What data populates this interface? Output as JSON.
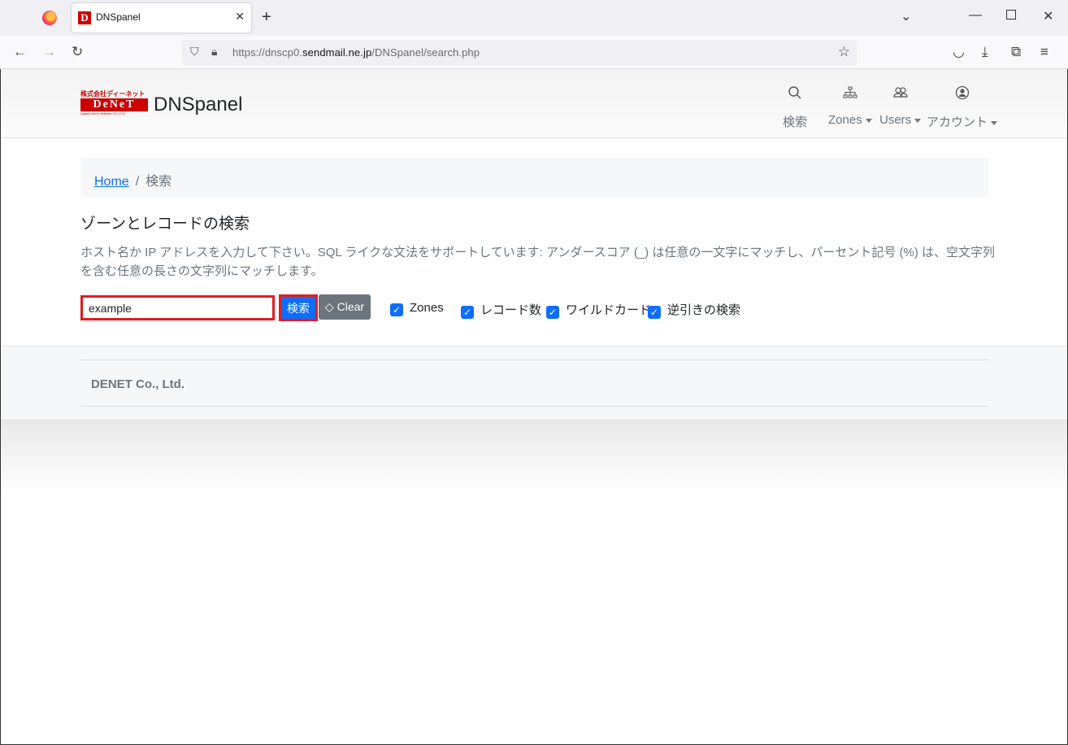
{
  "browser": {
    "tab_title": "DNSpanel",
    "tab_favicon": "D",
    "url_prefix": "https://dnscp0.",
    "url_domain": "sendmail.ne.jp",
    "url_path": "/DNSpanel/search.php"
  },
  "header": {
    "logo_top": "株式会社ディーネット",
    "logo_mid": "DeNeT",
    "logo_bottom": "Digital-Effect Network CO.,LTD.",
    "brand": "DNSpanel",
    "nav": {
      "search": "検索",
      "zones": "Zones",
      "users": "Users",
      "account": "アカウント"
    }
  },
  "breadcrumb": {
    "home": "Home",
    "separator": "/",
    "current": "検索"
  },
  "main": {
    "title": "ゾーンとレコードの検索",
    "description": "ホスト名か IP アドレスを入力して下さい。SQL ライクな文法をサポートしています: アンダースコア (_) は任意の一文字にマッチし、パーセント記号 (%) は、空文字列を含む任意の長さの文字列にマッチします。",
    "search_value": "example",
    "search_button": "検索",
    "clear_button": "Clear",
    "checkboxes": {
      "zones": "Zones",
      "records": "レコード数",
      "wildcard": "ワイルドカード",
      "reverse": "逆引きの検索"
    }
  },
  "footer": {
    "text": "DENET Co., Ltd."
  },
  "colors": {
    "primary": "#0d6efd",
    "secondary": "#6c757d",
    "highlight": "#e31b23",
    "brand_red": "#cc0000"
  }
}
